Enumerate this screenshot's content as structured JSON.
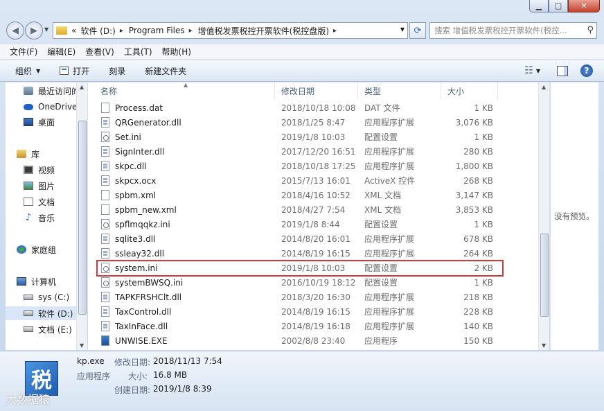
{
  "window": {
    "controls": {
      "minimize": "▁",
      "maximize": "□",
      "close": "✕"
    }
  },
  "address": {
    "overflow": "«",
    "crumbs": [
      "软件 (D:)",
      "Program Files",
      "增值税发票税控开票软件(税控盘版)"
    ],
    "separator": "▸",
    "search_placeholder": "搜索 增值税发票税控开票软件(税控..."
  },
  "menu": [
    "文件(F)",
    "编辑(E)",
    "查看(V)",
    "工具(T)",
    "帮助(H)"
  ],
  "toolbar": {
    "organize": "组织",
    "open": "打开",
    "burn": "刻录",
    "new_folder": "新建文件夹"
  },
  "nav": [
    {
      "label": "最近访问的",
      "icon": "recent"
    },
    {
      "label": "OneDrive",
      "icon": "cloud"
    },
    {
      "label": "桌面",
      "icon": "desk"
    },
    {
      "label": "库",
      "icon": "lib"
    },
    {
      "label": "视频",
      "icon": "video"
    },
    {
      "label": "图片",
      "icon": "pic"
    },
    {
      "label": "文档",
      "icon": "doc"
    },
    {
      "label": "音乐",
      "icon": "music"
    },
    {
      "label": "家庭组",
      "icon": "home"
    },
    {
      "label": "计算机",
      "icon": "pc"
    },
    {
      "label": "sys (C:)",
      "icon": "drive"
    },
    {
      "label": "软件 (D:)",
      "icon": "drive"
    },
    {
      "label": "文档 (E:)",
      "icon": "drive"
    }
  ],
  "columns": {
    "name": "名称",
    "date": "修改日期",
    "type": "类型",
    "size": "大小"
  },
  "files": [
    {
      "name": "Process.dat",
      "date": "2018/10/18 10:08",
      "type": "DAT 文件",
      "size": "1 KB",
      "kind": "dat"
    },
    {
      "name": "QRGenerator.dll",
      "date": "2018/1/25 8:47",
      "type": "应用程序扩展",
      "size": "3,076 KB",
      "kind": "dll"
    },
    {
      "name": "Set.ini",
      "date": "2019/1/8 10:03",
      "type": "配置设置",
      "size": "1 KB",
      "kind": "cfg"
    },
    {
      "name": "SignInter.dll",
      "date": "2017/12/20 16:51",
      "type": "应用程序扩展",
      "size": "280 KB",
      "kind": "dll"
    },
    {
      "name": "skpc.dll",
      "date": "2018/10/18 17:25",
      "type": "应用程序扩展",
      "size": "1,800 KB",
      "kind": "dll"
    },
    {
      "name": "skpcx.ocx",
      "date": "2015/7/13 16:01",
      "type": "ActiveX 控件",
      "size": "268 KB",
      "kind": "dll"
    },
    {
      "name": "spbm.xml",
      "date": "2018/4/16 10:52",
      "type": "XML 文档",
      "size": "3,147 KB",
      "kind": "xml"
    },
    {
      "name": "spbm_new.xml",
      "date": "2018/4/27 7:54",
      "type": "XML 文档",
      "size": "3,853 KB",
      "kind": "xml"
    },
    {
      "name": "spflmqqkz.ini",
      "date": "2019/1/8 8:44",
      "type": "配置设置",
      "size": "1 KB",
      "kind": "cfg"
    },
    {
      "name": "sqlite3.dll",
      "date": "2014/8/20 16:01",
      "type": "应用程序扩展",
      "size": "678 KB",
      "kind": "dll"
    },
    {
      "name": "ssleay32.dll",
      "date": "2014/8/19 16:15",
      "type": "应用程序扩展",
      "size": "264 KB",
      "kind": "dll"
    },
    {
      "name": "system.ini",
      "date": "2019/1/8 10:03",
      "type": "配置设置",
      "size": "2 KB",
      "kind": "cfg"
    },
    {
      "name": "systemBWSQ.ini",
      "date": "2016/10/19 18:12",
      "type": "配置设置",
      "size": "1 KB",
      "kind": "cfg"
    },
    {
      "name": "TAPKFRSHClt.dll",
      "date": "2018/3/20 16:30",
      "type": "应用程序扩展",
      "size": "218 KB",
      "kind": "dll"
    },
    {
      "name": "TaxControl.dll",
      "date": "2014/8/19 16:15",
      "type": "应用程序扩展",
      "size": "228 KB",
      "kind": "dll"
    },
    {
      "name": "TaxInFace.dll",
      "date": "2014/8/19 16:18",
      "type": "应用程序扩展",
      "size": "140 KB",
      "kind": "dll"
    },
    {
      "name": "UNWISE.EXE",
      "date": "2002/8/8 23:40",
      "type": "应用程序",
      "size": "150 KB",
      "kind": "exe"
    }
  ],
  "preview": {
    "empty_text": "没有预览。"
  },
  "details": {
    "icon_glyph": "税",
    "filename": "kp.exe",
    "filetype": "应用程序",
    "modified_label": "修改日期:",
    "modified_value": "2018/11/13 7:54",
    "size_label": "大小:",
    "size_value": "16.8 MB",
    "created_label": "创建日期:",
    "created_value": "2019/1/8 8:39"
  },
  "watermark": "大数据猿"
}
